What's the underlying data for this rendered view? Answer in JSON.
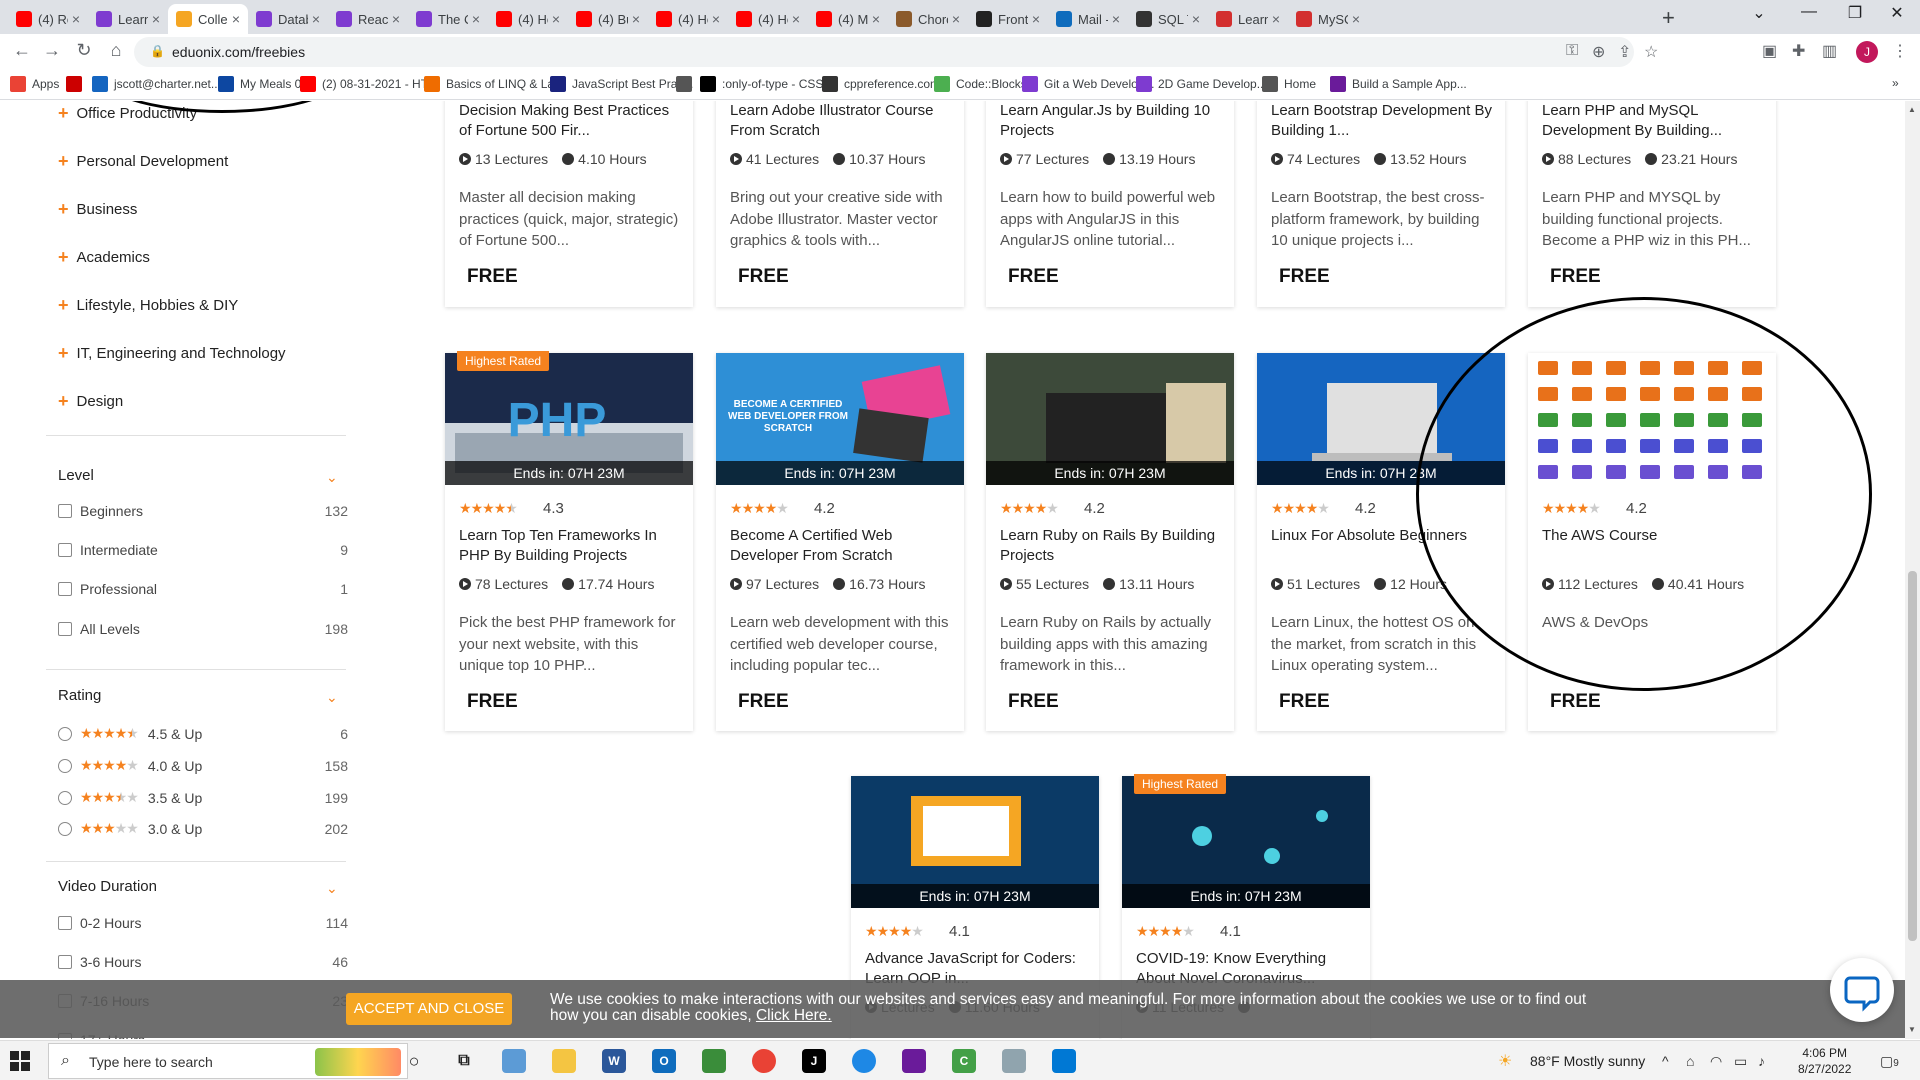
{
  "browser": {
    "tabs": [
      {
        "label": "(4) Ro",
        "icon": "youtube-icon",
        "color": "#ff0000"
      },
      {
        "label": "Learn",
        "icon": "site-icon",
        "color": "#7e3bd0"
      },
      {
        "label": "Collec",
        "icon": "eduonix-icon",
        "color": "#f5a623"
      },
      {
        "label": "Datab",
        "icon": "site-icon",
        "color": "#7e3bd0"
      },
      {
        "label": "React",
        "icon": "site-icon",
        "color": "#7e3bd0"
      },
      {
        "label": "The C",
        "icon": "site-icon",
        "color": "#7e3bd0"
      },
      {
        "label": "(4) Ho",
        "icon": "youtube-icon",
        "color": "#ff0000"
      },
      {
        "label": "(4) Bu",
        "icon": "youtube-icon",
        "color": "#ff0000"
      },
      {
        "label": "(4) Ho",
        "icon": "youtube-icon",
        "color": "#ff0000"
      },
      {
        "label": "(4) Ho",
        "icon": "youtube-icon",
        "color": "#ff0000"
      },
      {
        "label": "(4) My",
        "icon": "youtube-icon",
        "color": "#ff0000"
      },
      {
        "label": "Chorc",
        "icon": "site-icon",
        "color": "#8b5a2b"
      },
      {
        "label": "Front",
        "icon": "site-icon",
        "color": "#222222"
      },
      {
        "label": "Mail -",
        "icon": "outlook-icon",
        "color": "#0f6cbd"
      },
      {
        "label": "SQL T",
        "icon": "site-icon",
        "color": "#333333"
      },
      {
        "label": "Learn",
        "icon": "site-icon",
        "color": "#d32f2f"
      },
      {
        "label": "MySC",
        "icon": "site-icon",
        "color": "#d32f2f"
      }
    ],
    "url": "eduonix.com/freebies",
    "bookmarks": [
      {
        "label": "Apps",
        "icon": "apps-grid-icon",
        "color": "#ea4335"
      },
      {
        "label": "",
        "icon": "cnn-icon",
        "color": "#cc0000"
      },
      {
        "label": "jscott@charter.net...",
        "icon": "bookmark-icon",
        "color": "#1565c0"
      },
      {
        "label": "My Meals 0",
        "icon": "bookmark-icon",
        "color": "#0d47a1"
      },
      {
        "label": "(2) 08-31-2021 - HT...",
        "icon": "youtube-icon",
        "color": "#ff0000"
      },
      {
        "label": "Basics of LINQ & La...",
        "icon": "bookmark-icon",
        "color": "#ef6c00"
      },
      {
        "label": "JavaScript Best Prac...",
        "icon": "bookmark-icon",
        "color": "#1a237e"
      },
      {
        "label": "",
        "icon": "globe-icon",
        "color": "#555555"
      },
      {
        "label": ":only-of-type - CSS:...",
        "icon": "bookmark-icon",
        "color": "#000000"
      },
      {
        "label": "cppreference.com",
        "icon": "bookmark-icon",
        "color": "#333333"
      },
      {
        "label": "Code::Blocks",
        "icon": "bookmark-icon",
        "color": "#4caf50"
      },
      {
        "label": "Git a Web Develop...",
        "icon": "bookmark-icon",
        "color": "#7e3bd0"
      },
      {
        "label": "2D Game Develop...",
        "icon": "bookmark-icon",
        "color": "#7e3bd0"
      },
      {
        "label": "Home",
        "icon": "globe-icon",
        "color": "#555555"
      },
      {
        "label": "Build a Sample App...",
        "icon": "bookmark-icon",
        "color": "#6a1b9a"
      }
    ]
  },
  "sidebar": {
    "categories": [
      "Office Productivity",
      "Personal Development",
      "Business",
      "Academics",
      "Lifestyle, Hobbies & DIY",
      "IT, Engineering and Technology",
      "Design"
    ],
    "level": {
      "title": "Level",
      "options": [
        {
          "label": "Beginners",
          "count": "132"
        },
        {
          "label": "Intermediate",
          "count": "9"
        },
        {
          "label": "Professional",
          "count": "1"
        },
        {
          "label": "All Levels",
          "count": "198"
        }
      ]
    },
    "rating": {
      "title": "Rating",
      "options": [
        {
          "label": "4.5 & Up",
          "count": "6",
          "stars": 4.5
        },
        {
          "label": "4.0 & Up",
          "count": "158",
          "stars": 4.0
        },
        {
          "label": "3.5 & Up",
          "count": "199",
          "stars": 3.5
        },
        {
          "label": "3.0 & Up",
          "count": "202",
          "stars": 3.0
        }
      ]
    },
    "duration": {
      "title": "Video Duration",
      "options": [
        {
          "label": "0-2 Hours",
          "count": "114"
        },
        {
          "label": "3-6 Hours",
          "count": "46"
        },
        {
          "label": "7-16 Hours",
          "count": "23"
        },
        {
          "label": "17+ Hours",
          "count": ""
        }
      ]
    }
  },
  "courses": {
    "row1": [
      {
        "title": "Decision Making Best Practices of Fortune 500 Fir...",
        "lectures": "13 Lectures",
        "hours": "4.10 Hours",
        "desc": "Master all decision making practices (quick, major, strategic) of Fortune 500...",
        "price": "FREE"
      },
      {
        "title": "Learn Adobe Illustrator Course From Scratch",
        "lectures": "41 Lectures",
        "hours": "10.37 Hours",
        "desc": "Bring out your creative side with Adobe Illustrator. Master vector graphics & tools with...",
        "price": "FREE"
      },
      {
        "title": "Learn Angular.Js by Building 10 Projects",
        "lectures": "77 Lectures",
        "hours": "13.19 Hours",
        "desc": "Learn how to build powerful web apps with AngularJS in this AngularJS online tutorial...",
        "price": "FREE"
      },
      {
        "title": "Learn Bootstrap Development By Building 1...",
        "lectures": "74 Lectures",
        "hours": "13.52 Hours",
        "desc": "Learn Bootstrap, the best cross-platform framework, by building 10 unique projects i...",
        "price": "FREE"
      },
      {
        "title": "Learn PHP and MySQL Development By Building...",
        "lectures": "88 Lectures",
        "hours": "23.21 Hours",
        "desc": "Learn PHP and MYSQL by building functional projects. Become a PHP wiz in this PH...",
        "price": "FREE"
      }
    ],
    "row2": [
      {
        "badge": "Highest Rated",
        "ends": "Ends in: 07H 23M",
        "thumb_text": "PHP",
        "rating": "4.3",
        "stars": 4.3,
        "title": "Learn Top Ten Frameworks In PHP By Building Projects",
        "lectures": "78 Lectures",
        "hours": "17.74 Hours",
        "desc": "Pick the best PHP framework for your next website, with this unique top 10 PHP...",
        "price": "FREE"
      },
      {
        "badge": "",
        "ends": "Ends in: 07H 23M",
        "thumb_text": "BECOME A CERTIFIED WEB DEVELOPER FROM SCRATCH",
        "rating": "4.2",
        "stars": 4.2,
        "title": "Become A Certified Web Developer From Scratch",
        "lectures": "97 Lectures",
        "hours": "16.73 Hours",
        "desc": "Learn web development with this certified web developer course, including popular tec...",
        "price": "FREE"
      },
      {
        "badge": "",
        "ends": "Ends in: 07H 23M",
        "thumb_text": "",
        "rating": "4.2",
        "stars": 4.2,
        "title": "Learn Ruby on Rails By Building Projects",
        "lectures": "55 Lectures",
        "hours": "13.11 Hours",
        "desc": "Learn Ruby on Rails by actually building apps with this amazing framework in this...",
        "price": "FREE"
      },
      {
        "badge": "",
        "ends": "Ends in: 07H 23M",
        "thumb_text": "",
        "rating": "4.2",
        "stars": 4.2,
        "title": "Linux For Absolute Beginners",
        "lectures": "51 Lectures",
        "hours": "12 Hours",
        "desc": "Learn Linux, the hottest OS on the market, from scratch in this Linux operating system...",
        "price": "FREE"
      },
      {
        "badge": "",
        "ends": "",
        "thumb_text": "",
        "rating": "4.2",
        "stars": 4.2,
        "title": "The AWS Course",
        "lectures": "112 Lectures",
        "hours": "40.41 Hours",
        "desc": "AWS & DevOps",
        "price": "FREE"
      }
    ],
    "row3": [
      {
        "badge": "",
        "ends": "Ends in: 07H 23M",
        "rating": "4.1",
        "stars": 4.1,
        "title": "Advance JavaScript for Coders: Learn OOP in...",
        "lectures": "Lectures",
        "hours": "11.60 Hours"
      },
      {
        "badge": "Highest Rated",
        "ends": "Ends in: 07H 23M",
        "rating": "4.1",
        "stars": 4.1,
        "title": "COVID-19: Know Everything About Novel Coronavirus...",
        "lectures": "11 Lectures",
        "hours": ""
      }
    ]
  },
  "cookie": {
    "button": "ACCEPT AND CLOSE",
    "text": "We use cookies to make interactions with our websites and services easy and meaningful. For more information about the cookies we use or to find out how you can disable cookies,",
    "link": "Click Here."
  },
  "taskbar": {
    "search_placeholder": "Type here to search",
    "weather": "88°F  Mostly sunny",
    "time": "4:06 PM",
    "date": "8/27/2022",
    "notifications": "9"
  },
  "colors": {
    "accent": "#f5821f",
    "cookie_button": "#f5a623",
    "tab_bar": "#dee1e6"
  }
}
